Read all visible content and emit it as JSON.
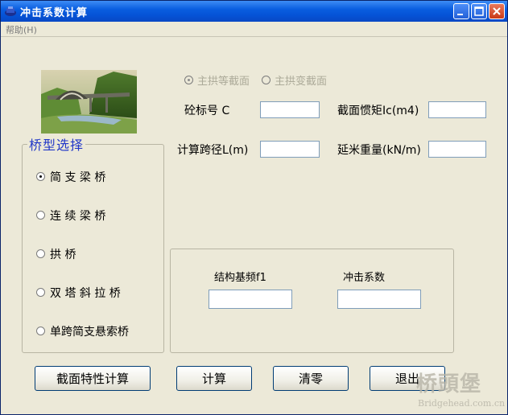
{
  "window": {
    "title": "冲击系数计算"
  },
  "menu": {
    "help": "帮助(H)"
  },
  "arch_options": {
    "equal": "主拱等截面",
    "variable": "主拱变截面",
    "selected": "equal"
  },
  "bridge_type": {
    "legend": "桥型选择",
    "options": [
      {
        "label": "简 支 梁 桥",
        "selected": true
      },
      {
        "label": "连 续 梁 桥",
        "selected": false
      },
      {
        "label": "拱 桥",
        "selected": false
      },
      {
        "label": "双 塔 斜 拉 桥",
        "selected": false
      },
      {
        "label": "单跨简支悬索桥",
        "selected": false
      }
    ]
  },
  "fields": {
    "concrete_grade": {
      "label": "砼标号 C",
      "value": ""
    },
    "inertia": {
      "label": "截面惯矩Ic(m4)",
      "value": ""
    },
    "span": {
      "label": "计算跨径L(m)",
      "value": ""
    },
    "weight": {
      "label": "延米重量(kN/m)",
      "value": ""
    }
  },
  "results": {
    "frequency": {
      "label": "结构基频f1",
      "value": ""
    },
    "impact": {
      "label": "冲击系数",
      "value": ""
    }
  },
  "buttons": {
    "section": "截面特性计算",
    "compute": "计算",
    "clear": "清零",
    "exit": "退出"
  },
  "watermark": {
    "cn": "桥頭堡",
    "en": "Bridgehead.com.cn"
  },
  "colors": {
    "titlebar": "#0a5ee0",
    "window_bg": "#ece9d8",
    "legend": "#2137c8"
  }
}
